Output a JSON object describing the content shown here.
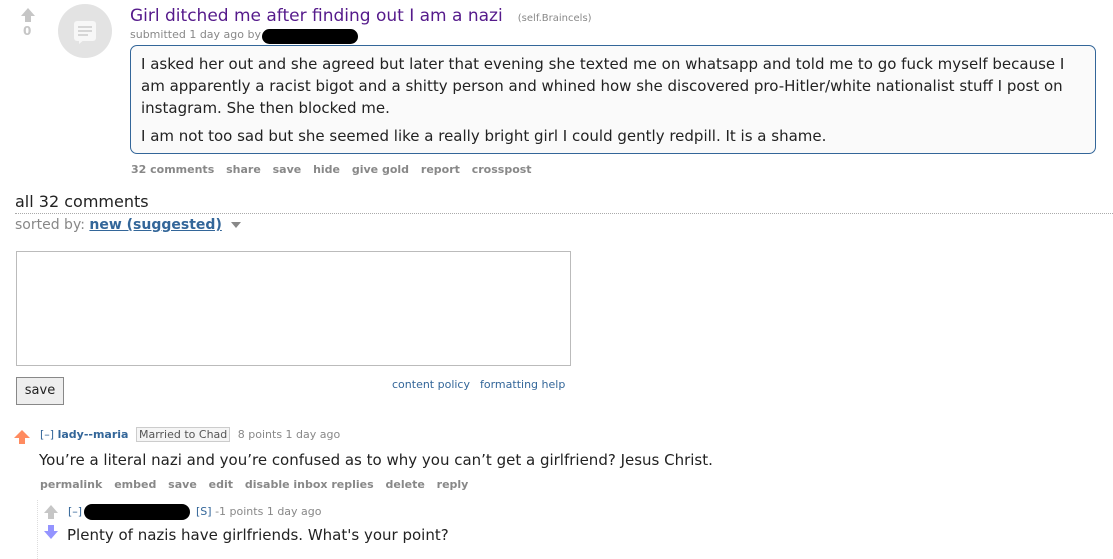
{
  "post": {
    "score": "0",
    "title": "Girl ditched me after finding out I am a nazi",
    "domain": "(self.Braincels)",
    "submitted": "submitted 1 day ago by",
    "selftext": [
      "I asked her out and she agreed but later that evening she texted me on whatsapp and told me to go fuck myself because I am apparently a racist bigot and a shitty person and whined how she discovered pro-Hitler/white nationalist stuff I post on instagram. She then blocked me.",
      "I am not too sad but she seemed like a really bright girl I could gently redpill. It is a shame."
    ],
    "buttons": {
      "comments": "32 comments",
      "share": "share",
      "save": "save",
      "hide": "hide",
      "give_gold": "give gold",
      "report": "report",
      "crosspost": "crosspost"
    }
  },
  "comments_area": {
    "heading": "all 32 comments",
    "sorted_label": "sorted by:",
    "sort_value": "new (suggested)",
    "save_label": "save",
    "content_policy": "content policy",
    "formatting_help": "formatting help"
  },
  "comments": [
    {
      "expand": "[–]",
      "author": "lady--maria",
      "flair": "Married to Chad",
      "meta": "8 points 1 day ago",
      "body": "You’re a literal nazi and you’re confused as to why you can’t get a girlfriend? Jesus Christ.",
      "buttons": {
        "permalink": "permalink",
        "embed": "embed",
        "save": "save",
        "edit": "edit",
        "disable": "disable inbox replies",
        "delete": "delete",
        "reply": "reply"
      }
    },
    {
      "expand": "[–]",
      "submitter_tag": "[S]",
      "meta": "-1 points 1 day ago",
      "body": "Plenty of nazis have girlfriends. What's your point?"
    }
  ],
  "colors": {
    "title": "#551a8b",
    "link": "#336699",
    "upvote": "#ff8b60",
    "downvote": "#9494ff",
    "selftext_border": "#336699"
  }
}
